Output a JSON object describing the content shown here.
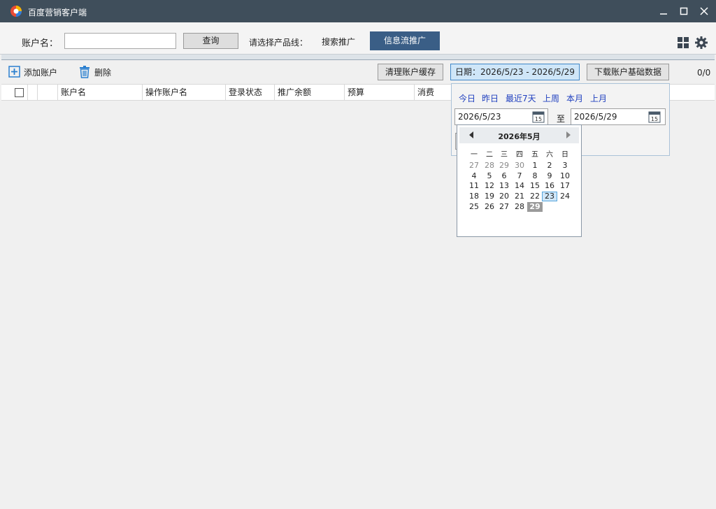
{
  "window": {
    "title": "百度营销客户端"
  },
  "search": {
    "account_label": "账户名：",
    "account_value": "",
    "query_label": "查询",
    "product_line_label": "请选择产品线：",
    "tabs": [
      "搜索推广",
      "信息流推广"
    ],
    "active_tab": "信息流推广"
  },
  "toolbar": {
    "add_label": "添加账户",
    "delete_label": "删除",
    "clear_cache_label": "清理账户缓存",
    "date_range_label": "日期：2026/5/23 - 2026/5/29",
    "download_label": "下载账户基础数据",
    "count": "0/0"
  },
  "table": {
    "columns": [
      "账户名",
      "操作账户名",
      "登录状态",
      "推广余额",
      "预算",
      "消费"
    ]
  },
  "date_picker": {
    "quick_ranges": [
      "今日",
      "昨日",
      "最近7天",
      "上周",
      "本月",
      "上月"
    ],
    "start": "2026/5/23",
    "end": "2026/5/29",
    "to_label": "至",
    "calendar": {
      "month_title": "2026年5月",
      "weekdays": [
        "一",
        "二",
        "三",
        "四",
        "五",
        "六",
        "日"
      ],
      "weeks": [
        [
          "27",
          "28",
          "29",
          "30",
          "1",
          "2",
          "3"
        ],
        [
          "4",
          "5",
          "6",
          "7",
          "8",
          "9",
          "10"
        ],
        [
          "11",
          "12",
          "13",
          "14",
          "15",
          "16",
          "17"
        ],
        [
          "18",
          "19",
          "20",
          "21",
          "22",
          "23",
          "24"
        ],
        [
          "25",
          "26",
          "27",
          "28",
          "29"
        ]
      ],
      "range_start_day": "23",
      "range_end_day": "29"
    }
  },
  "colors": {
    "titlebar": "#3f4e5b",
    "active_tab": "#3a5e86",
    "link": "#1f3fbf",
    "selected_day": "#9a9a9a"
  }
}
